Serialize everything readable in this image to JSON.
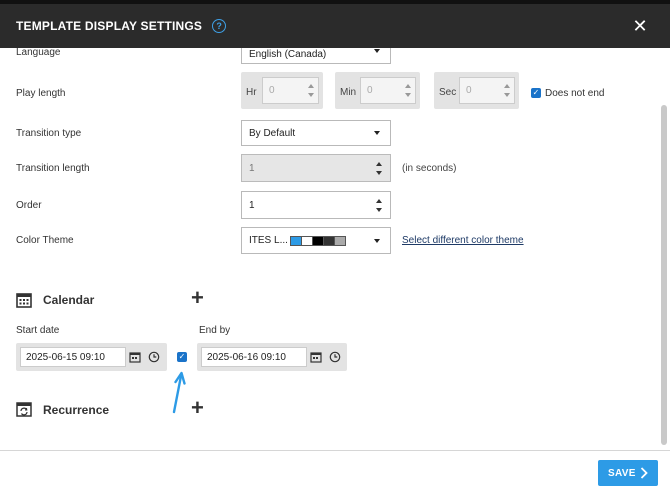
{
  "header": {
    "title": "TEMPLATE DISPLAY SETTINGS",
    "help_glyph": "?",
    "close_glyph": "✕"
  },
  "form": {
    "language": {
      "label": "Language",
      "value": "English (Canada)"
    },
    "play_length": {
      "label": "Play length",
      "hr_label": "Hr",
      "hr_value": "0",
      "min_label": "Min",
      "min_value": "0",
      "sec_label": "Sec",
      "sec_value": "0",
      "does_not_end_label": "Does not end",
      "does_not_end_checked": true
    },
    "transition_type": {
      "label": "Transition type",
      "value": "By Default"
    },
    "transition_length": {
      "label": "Transition length",
      "value": "1",
      "unit": "(in seconds)"
    },
    "order": {
      "label": "Order",
      "value": "1"
    },
    "color_theme": {
      "label": "Color Theme",
      "value": "ITES L...",
      "swatches": [
        "#2d9be6",
        "#ffffff",
        "#000000",
        "#333333",
        "#aaaaaa"
      ],
      "link": "Select different color theme"
    }
  },
  "calendar": {
    "title": "Calendar",
    "start_label": "Start date",
    "start_value": "2025-06-15 09:10",
    "end_label": "End by",
    "end_value": "2025-06-16 09:10",
    "end_enabled": true
  },
  "recurrence": {
    "title": "Recurrence"
  },
  "footer": {
    "save_label": "SAVE"
  },
  "colors": {
    "accent": "#2d9be6",
    "header_bg": "#2b2b2b",
    "arrow": "#2d9be6"
  }
}
